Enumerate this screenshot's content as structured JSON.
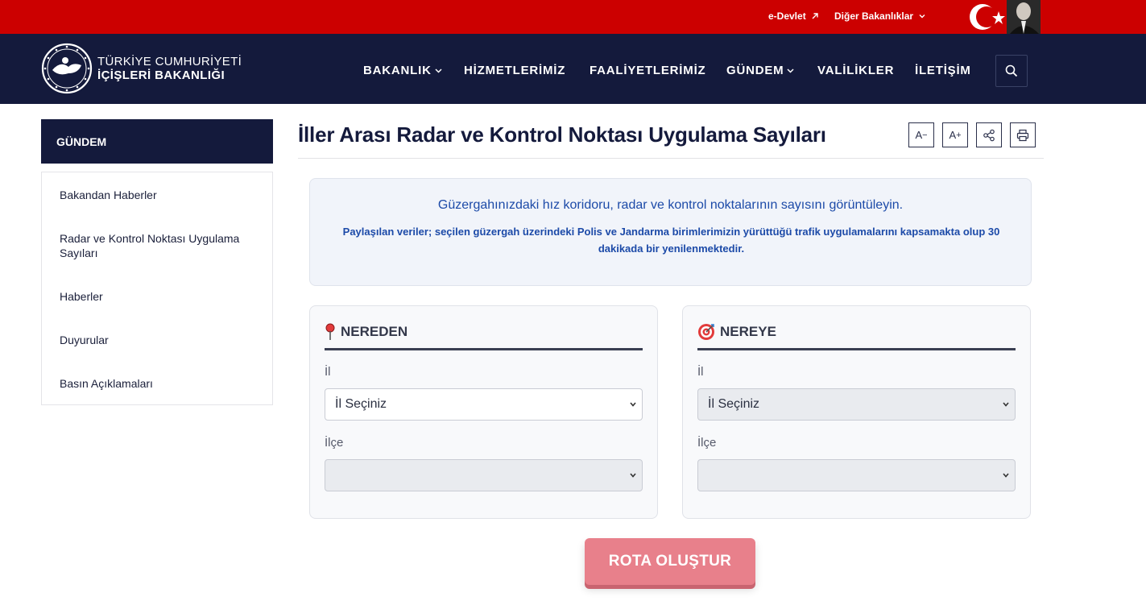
{
  "topbar": {
    "edevlet_label": "e-Devlet",
    "diger_label": "Diğer Bakanlıklar",
    "bg_color": "#cc0000"
  },
  "logo": {
    "line1": "TÜRKİYE CUMHURİYETİ",
    "line2": "İÇİŞLERİ BAKANLIĞI"
  },
  "nav": {
    "items": [
      "BAKANLIK",
      "HİZMETLERİMİZ",
      "FAALİYETLERİMİZ",
      "GÜNDEM",
      "VALİLİKLER",
      "İLETİŞİM"
    ],
    "bg_color": "#141a3c"
  },
  "sidebar": {
    "heading": "GÜNDEM",
    "items": [
      "Bakandan Haberler",
      "Radar ve Kontrol Noktası Uygulama Sayıları",
      "Haberler",
      "Duyurular",
      "Basın Açıklamaları"
    ]
  },
  "page": {
    "title": "İller Arası Radar ve Kontrol Noktası Uygulama Sayıları",
    "tools": {
      "font_decrease": "A",
      "font_increase": "A"
    }
  },
  "info": {
    "headline": "Güzergahınızdaki hız koridoru, radar ve kontrol noktalarının sayısını görüntüleyin.",
    "detail": "Paylaşılan veriler; seçilen güzergah üzerindeki Polis ve Jandarma birimlerimizin yürüttüğü trafik uygulamalarını kapsamakta olup 30 dakikada bir yenilenmektedir."
  },
  "from_card": {
    "title": "NEREDEN",
    "il_label": "İl",
    "il_value": "İl Seçiniz",
    "ilce_label": "İlçe",
    "ilce_value": ""
  },
  "to_card": {
    "title": "NEREYE",
    "il_label": "İl",
    "il_value": "İl Seçiniz",
    "ilce_label": "İlçe",
    "ilce_value": ""
  },
  "route_button": {
    "label": "ROTA OLUŞTUR",
    "color": "#e8808b"
  }
}
